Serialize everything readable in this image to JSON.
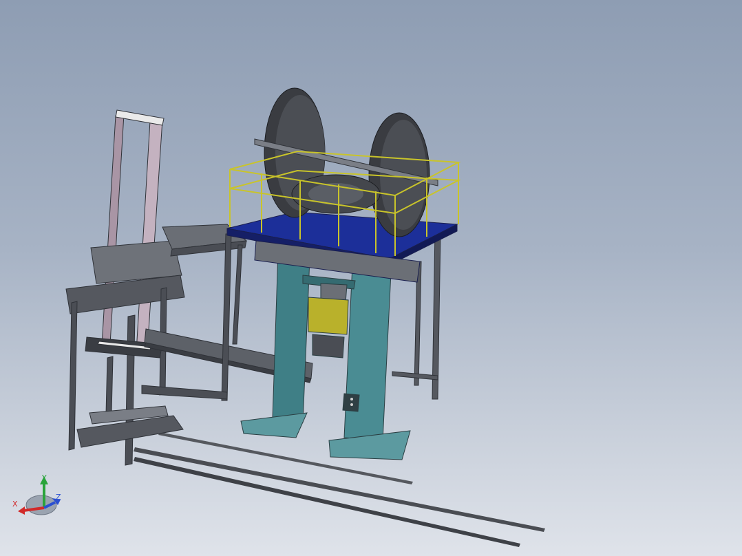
{
  "colors": {
    "background_top": "#8e9db3",
    "background_bottom": "#dfe3ea",
    "frame_gray": "#5b5f66",
    "frame_dark": "#2f3238",
    "machine_teal": "#3f7f86",
    "platform_blue": "#1c2f99",
    "railing_yellow": "#c9c42a",
    "flywheel_dark": "#3a3c41",
    "ram_yellow": "#b9b12b",
    "light_panel": "#d9c9d3"
  },
  "triad": {
    "x_label": "X",
    "y_label": "Y",
    "z_label": "Z",
    "x_color": "#d12a2a",
    "y_color": "#29a43a",
    "z_color": "#2a4fd1"
  }
}
